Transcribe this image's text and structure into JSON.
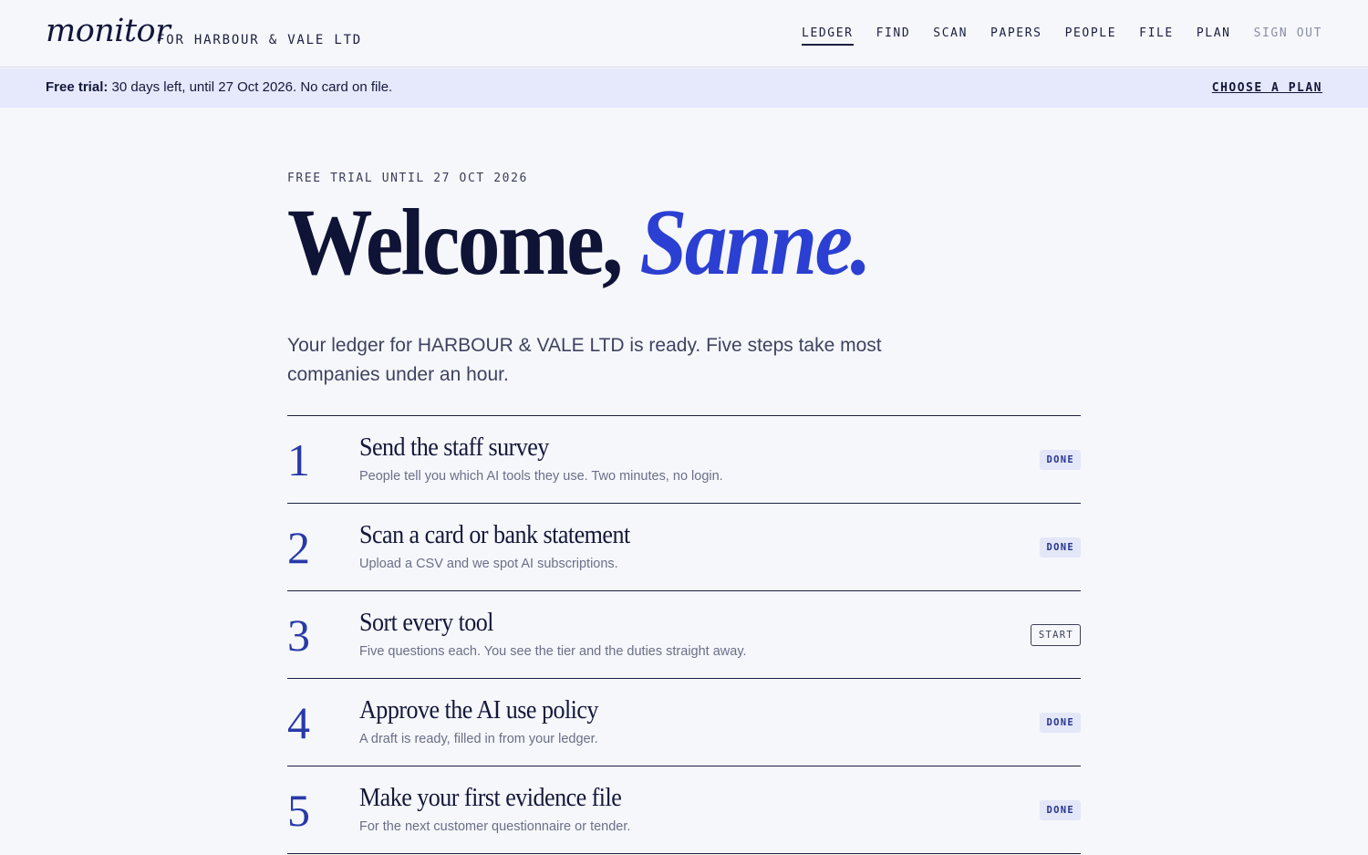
{
  "header": {
    "brand": "monitor",
    "company": "FOR HARBOUR & VALE LTD",
    "nav": [
      "LEDGER",
      "FIND",
      "SCAN",
      "PAPERS",
      "PEOPLE",
      "FILE",
      "PLAN"
    ],
    "active_nav": "LEDGER",
    "sign_out": "SIGN OUT"
  },
  "trial_banner": {
    "label": "Free trial:",
    "text": "30 days left, until 27 Oct 2026. No card on file.",
    "cta": "CHOOSE A PLAN"
  },
  "main": {
    "eyebrow": "FREE TRIAL UNTIL 27 OCT 2026",
    "greeting": "Welcome,",
    "name": "Sanne.",
    "intro": "Your ledger for HARBOUR & VALE LTD is ready. Five steps take most companies under an hour.",
    "steps": [
      {
        "num": "1",
        "title": "Send the staff survey",
        "desc": "People tell you which AI tools they use. Two minutes, no login.",
        "status": "DONE"
      },
      {
        "num": "2",
        "title": "Scan a card or bank statement",
        "desc": "Upload a CSV and we spot AI subscriptions.",
        "status": "DONE"
      },
      {
        "num": "3",
        "title": "Sort every tool",
        "desc": "Five questions each. You see the tier and the duties straight away.",
        "status": "START"
      },
      {
        "num": "4",
        "title": "Approve the AI use policy",
        "desc": "A draft is ready, filled in from your ledger.",
        "status": "DONE"
      },
      {
        "num": "5",
        "title": "Make your first evidence file",
        "desc": "For the next customer questionnaire or tender.",
        "status": "DONE"
      }
    ]
  },
  "colors": {
    "accent": "#2b3fd2",
    "banner_bg": "#e6e9fb",
    "page_bg": "#f6f7fb"
  }
}
